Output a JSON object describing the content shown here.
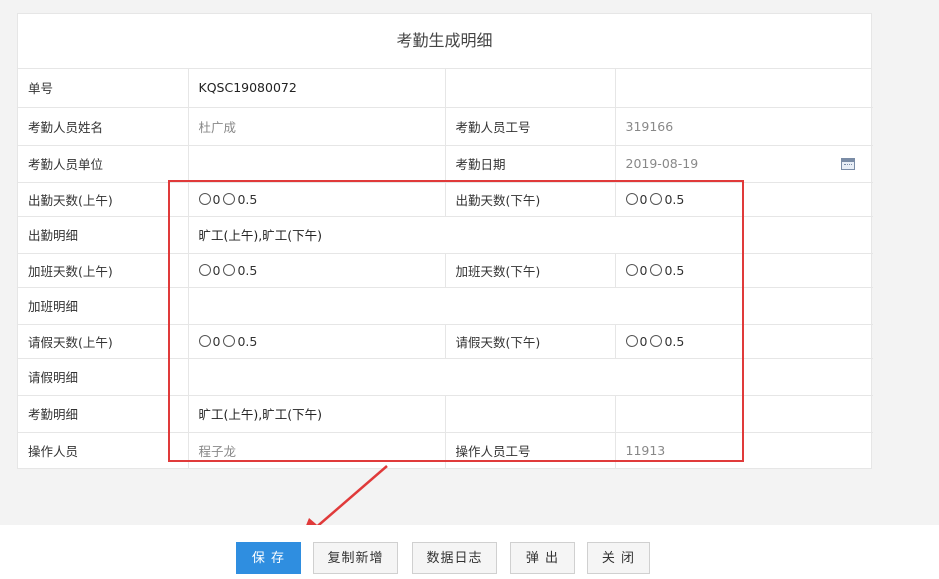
{
  "form": {
    "title": "考勤生成明细",
    "order_no_label": "单号",
    "order_no": "KQSC19080072",
    "name_label": "考勤人员姓名",
    "name": "杜广成",
    "emp_no_label": "考勤人员工号",
    "emp_no": "319166",
    "unit_label": "考勤人员单位",
    "unit": "",
    "date_label": "考勤日期",
    "date": "2019-08-19",
    "att_am_label": "出勤天数(上午)",
    "att_pm_label": "出勤天数(下午)",
    "att_detail_label": "出勤明细",
    "att_detail": "旷工(上午),旷工(下午)",
    "ot_am_label": "加班天数(上午)",
    "ot_pm_label": "加班天数(下午)",
    "ot_detail_label": "加班明细",
    "ot_detail": "",
    "leave_am_label": "请假天数(上午)",
    "leave_pm_label": "请假天数(下午)",
    "leave_detail_label": "请假明细",
    "leave_detail": "",
    "kq_detail_label": "考勤明细",
    "kq_detail": "旷工(上午),旷工(下午)",
    "operator_label": "操作人员",
    "operator": "程子龙",
    "operator_no_label": "操作人员工号",
    "operator_no": "11913",
    "radio_opt0": "0",
    "radio_opt1": "0.5"
  },
  "buttons": {
    "save": "保 存",
    "copy_new": "复制新增",
    "log": "数据日志",
    "popup": "弹 出",
    "close": "关 闭"
  },
  "colors": {
    "primary": "#2f8ee0",
    "highlight": "#e03a3a"
  }
}
